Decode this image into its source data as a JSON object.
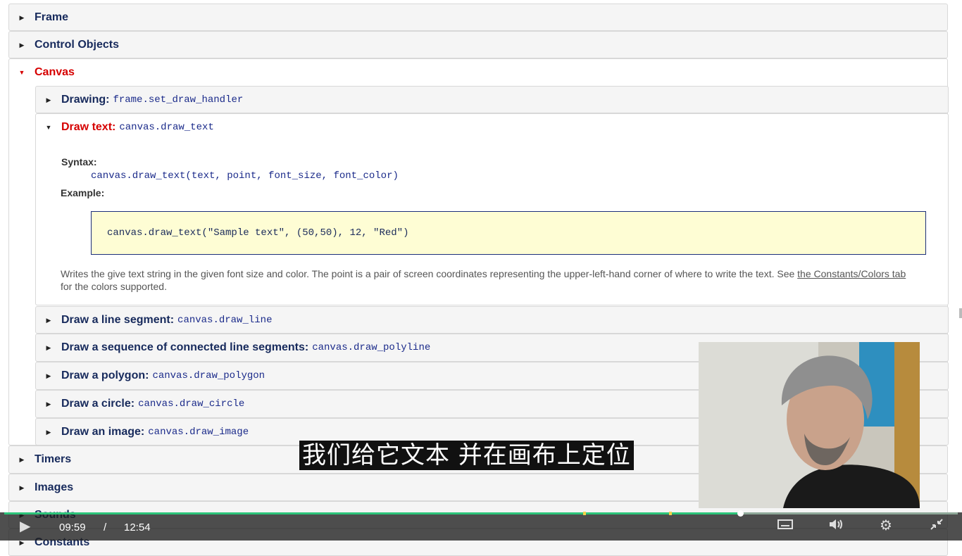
{
  "sections": {
    "frame": "Frame",
    "control_objects": "Control Objects",
    "canvas": "Canvas",
    "timers": "Timers",
    "images": "Images",
    "sounds": "Sounds",
    "constants": "Constants"
  },
  "canvas_items": [
    {
      "label": "Drawing:",
      "code": "frame.set_draw_handler"
    },
    {
      "label": "Draw text:",
      "code": "canvas.draw_text"
    },
    {
      "label": "Draw a line segment:",
      "code": "canvas.draw_line"
    },
    {
      "label": "Draw a sequence of connected line segments:",
      "code": "canvas.draw_polyline"
    },
    {
      "label": "Draw a polygon:",
      "code": "canvas.draw_polygon"
    },
    {
      "label": "Draw a circle:",
      "code": "canvas.draw_circle"
    },
    {
      "label": "Draw an image:",
      "code": "canvas.draw_image"
    }
  ],
  "draw_text_detail": {
    "syntax_label": "Syntax:",
    "syntax_code": "canvas.draw_text(text, point, font_size, font_color)",
    "example_label": "Example:",
    "example_code": "canvas.draw_text(\"Sample text\", (50,50), 12, \"Red\")",
    "desc_text": "Writes the give text string in the given font size and color. The point is a pair of screen coordinates representing the upper-left-hand corner of where to write the text. See ",
    "desc_link": "the Constants/Colors tab",
    "desc_tail": " for the colors supported."
  },
  "subtitle": "我们给它文本  并在画布上定位",
  "player": {
    "current_time": "09:59",
    "separator": "/",
    "duration": "12:54",
    "progress": 0.772
  },
  "icons": {
    "play": "play-icon",
    "captions": "captions-icon",
    "volume": "volume-icon",
    "settings": "gear-icon",
    "fullscreen": "exit-fullscreen-icon"
  },
  "colors": {
    "active_header": "#d60000",
    "header_text": "#172a5c",
    "code_text": "#1a2a8a",
    "example_bg": "#fefdd4",
    "progress": "#2cc47a"
  }
}
